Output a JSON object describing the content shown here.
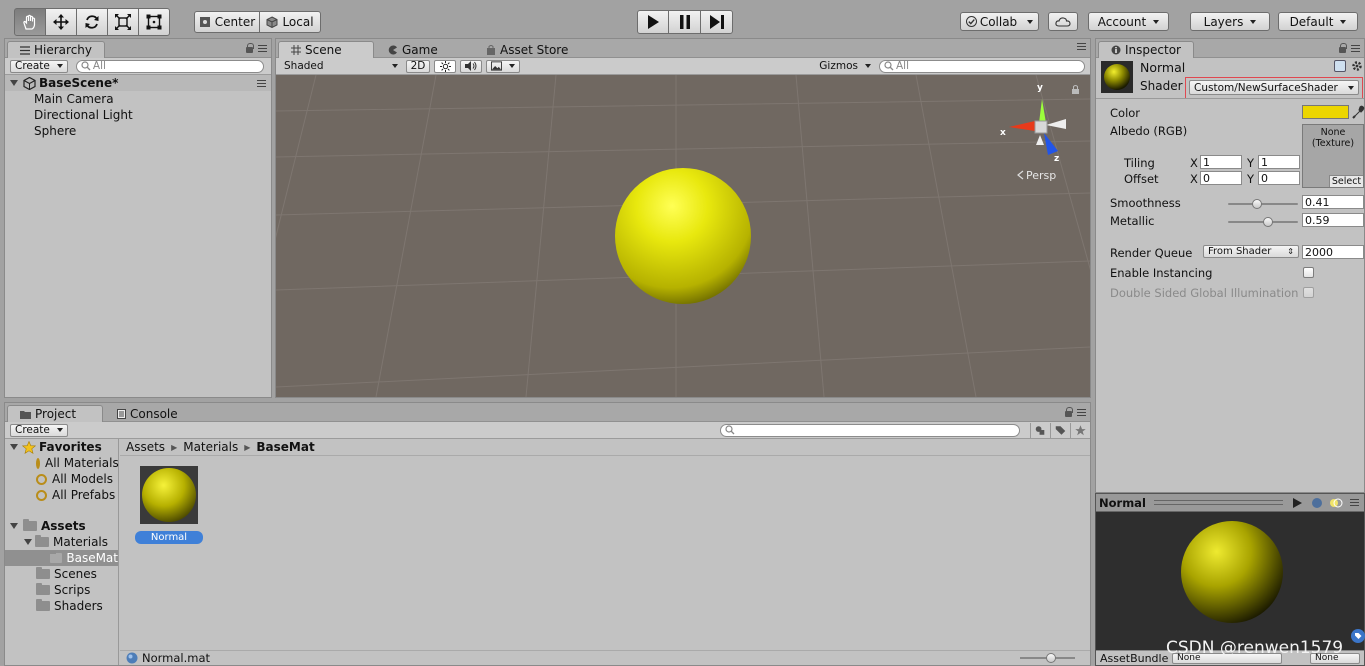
{
  "toolbar": {
    "tools": [
      "hand-tool",
      "move-tool",
      "rotate-tool",
      "scale-tool",
      "rect-tool"
    ],
    "pivot": "Center",
    "space": "Local",
    "collab": "Collab",
    "account": "Account",
    "layers": "Layers",
    "layout": "Default"
  },
  "hierarchy": {
    "tab": "Hierarchy",
    "create": "Create",
    "search_placeholder": "All",
    "scene": "BaseScene*",
    "items": [
      "Main Camera",
      "Directional Light",
      "Sphere"
    ]
  },
  "scene_view": {
    "tabs": [
      "Scene",
      "Game",
      "Asset Store"
    ],
    "shading": "Shaded",
    "mode_2d": "2D",
    "gizmos": "Gizmos",
    "search_placeholder": "All",
    "persp": "Persp",
    "axes": {
      "x": "x",
      "y": "y",
      "z": "z"
    },
    "background": "#706861",
    "sphere_color": "#e8e80e"
  },
  "inspector": {
    "tab": "Inspector",
    "material_name": "Normal",
    "shader_label": "Shader",
    "shader_value": "Custom/NewSurfaceShader",
    "color_label": "Color",
    "color_value": "#ecd600",
    "albedo_label": "Albedo (RGB)",
    "texture_none": "None",
    "texture_type": "(Texture)",
    "texture_select": "Select",
    "tiling_label": "Tiling",
    "offset_label": "Offset",
    "tiling": {
      "x_label": "X",
      "x": "1",
      "y_label": "Y",
      "y": "1"
    },
    "offset": {
      "x_label": "X",
      "x": "0",
      "y_label": "Y",
      "y": "0"
    },
    "smoothness_label": "Smoothness",
    "smoothness": "0.41",
    "metallic_label": "Metallic",
    "metallic": "0.59",
    "render_queue_label": "Render Queue",
    "render_queue_mode": "From Shader",
    "render_queue_value": "2000",
    "instancing_label": "Enable Instancing",
    "dsgi_label": "Double Sided Global Illumination",
    "preview_title": "Normal",
    "assetbundle_label": "AssetBundle",
    "assetbundle_value": "None",
    "assetbundle_variant": "None"
  },
  "project": {
    "tabs": [
      "Project",
      "Console"
    ],
    "create": "Create",
    "favorites_label": "Favorites",
    "favorites": [
      "All Materials",
      "All Models",
      "All Prefabs"
    ],
    "assets_label": "Assets",
    "materials_label": "Materials",
    "basemat_label": "BaseMat",
    "folders": [
      "Scenes",
      "Scrips",
      "Shaders"
    ],
    "breadcrumb": [
      "Assets",
      "Materials",
      "BaseMat"
    ],
    "asset_name": "Normal",
    "status_file": "Normal.mat"
  },
  "watermark": "CSDN @renwen1579"
}
